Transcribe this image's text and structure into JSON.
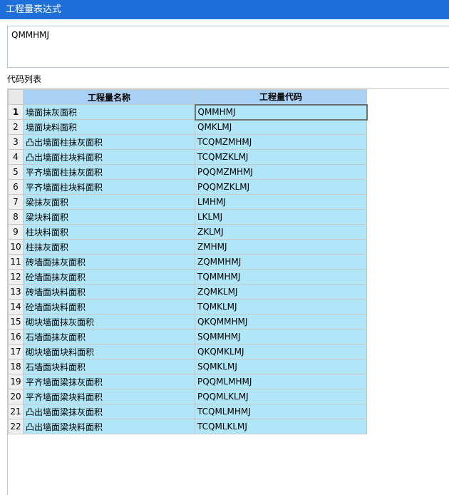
{
  "window": {
    "title": "工程量表达式"
  },
  "expression": {
    "value": "QMMHMJ"
  },
  "code_list": {
    "label": "代码列表",
    "columns": [
      "工程量名称",
      "工程量代码"
    ],
    "selected_row": 1,
    "rows": [
      {
        "num": "1",
        "name": "墙面抹灰面积",
        "code": "QMMHMJ"
      },
      {
        "num": "2",
        "name": "墙面块料面积",
        "code": "QMKLMJ"
      },
      {
        "num": "3",
        "name": "凸出墙面柱抹灰面积",
        "code": "TCQMZMHMJ"
      },
      {
        "num": "4",
        "name": "凸出墙面柱块料面积",
        "code": "TCQMZKLMJ"
      },
      {
        "num": "5",
        "name": "平齐墙面柱抹灰面积",
        "code": "PQQMZMHMJ"
      },
      {
        "num": "6",
        "name": "平齐墙面柱块料面积",
        "code": "PQQMZKLMJ"
      },
      {
        "num": "7",
        "name": "梁抹灰面积",
        "code": "LMHMJ"
      },
      {
        "num": "8",
        "name": "梁块料面积",
        "code": "LKLMJ"
      },
      {
        "num": "9",
        "name": "柱块料面积",
        "code": "ZKLMJ"
      },
      {
        "num": "10",
        "name": "柱抹灰面积",
        "code": "ZMHMJ"
      },
      {
        "num": "11",
        "name": "砖墙面抹灰面积",
        "code": "ZQMMHMJ"
      },
      {
        "num": "12",
        "name": "砼墙面抹灰面积",
        "code": "TQMMHMJ"
      },
      {
        "num": "13",
        "name": "砖墙面块料面积",
        "code": "ZQMKLMJ"
      },
      {
        "num": "14",
        "name": "砼墙面块料面积",
        "code": "TQMKLMJ"
      },
      {
        "num": "15",
        "name": "砌块墙面抹灰面积",
        "code": "QKQMMHMJ"
      },
      {
        "num": "16",
        "name": "石墙面抹灰面积",
        "code": "SQMMHMJ"
      },
      {
        "num": "17",
        "name": "砌块墙面块料面积",
        "code": "QKQMKLMJ"
      },
      {
        "num": "18",
        "name": "石墙面块料面积",
        "code": "SQMKLMJ"
      },
      {
        "num": "19",
        "name": "平齐墙面梁抹灰面积",
        "code": "PQQMLMHMJ"
      },
      {
        "num": "20",
        "name": "平齐墙面梁块料面积",
        "code": "PQQMLKLMJ"
      },
      {
        "num": "21",
        "name": "凸出墙面梁抹灰面积",
        "code": "TCQMLMHMJ"
      },
      {
        "num": "22",
        "name": "凸出墙面梁块料面积",
        "code": "TCQMLKLMJ"
      }
    ]
  },
  "colors": {
    "titlebar": "#1e6fd9",
    "header": "#a9d0f5",
    "cell": "#b0e6f7"
  }
}
